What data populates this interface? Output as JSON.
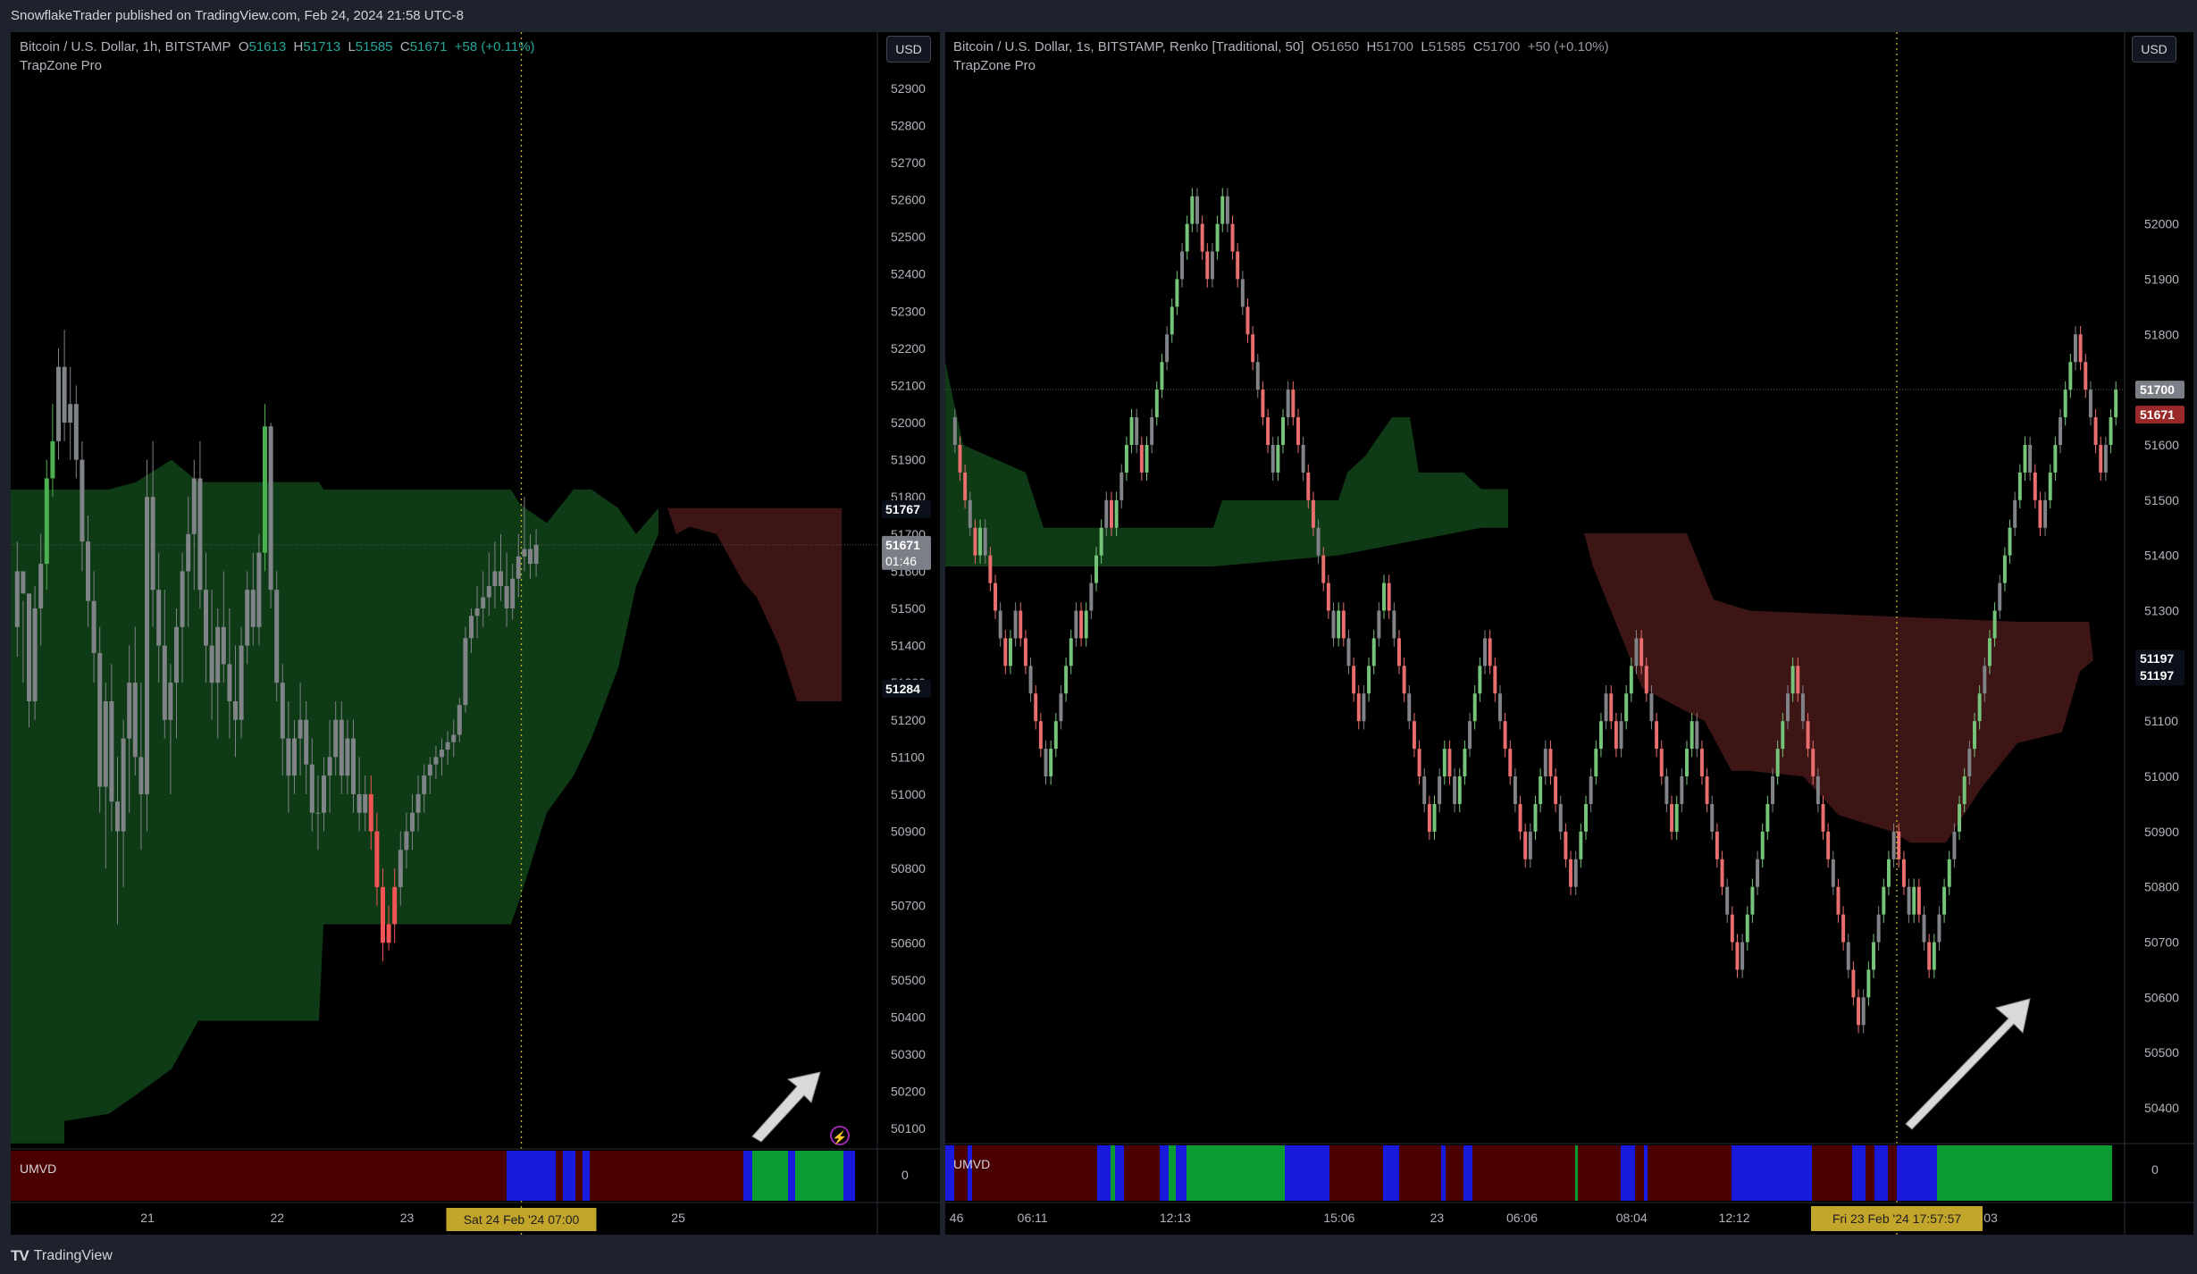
{
  "header": {
    "published": "SnowflakeTrader published on TradingView.com, Feb 24, 2024 21:58 UTC-8"
  },
  "footer": {
    "brand": "TradingView",
    "logo_icon": "tradingview-logo-icon"
  },
  "colors": {
    "bull": "#4caf50",
    "bear": "#f05454",
    "neutral": "#808489",
    "green_zone": "#0f3a16",
    "red_zone": "#3d1515",
    "umvd_red": "#4a0000",
    "umvd_blue": "#1a1adc",
    "umvd_green": "#0b9b32",
    "crosshair": "#c9b92a"
  },
  "left": {
    "legend": {
      "symbol": "Bitcoin / U.S. Dollar, 1h, BITSTAMP",
      "o_label": "O",
      "o": "51613",
      "h_label": "H",
      "h": "51713",
      "l_label": "L",
      "l": "51585",
      "c_label": "C",
      "c": "51671",
      "change": "+58 (+0.11%)"
    },
    "indicator": "TrapZone Pro",
    "currency": "USD",
    "umvd_label": "UMVD",
    "umvd_zero": "0",
    "price_badges": {
      "high": "51767",
      "last": "51671",
      "countdown": "01:46",
      "low": "51284"
    },
    "time_badge": "Sat 24 Feb '24   07:00"
  },
  "right": {
    "legend": {
      "symbol": "Bitcoin / U.S. Dollar, 1s, BITSTAMP, Renko [Traditional, 50]",
      "o_label": "O",
      "o": "51650",
      "h_label": "H",
      "h": "51700",
      "l_label": "L",
      "l": "51585",
      "c_label": "C",
      "c": "51700",
      "change": "+50 (+0.10%)"
    },
    "indicator": "TrapZone Pro",
    "currency": "USD",
    "umvd_label": "UMVD",
    "umvd_zero": "0",
    "price_badges": {
      "last": "51700",
      "ref": "51671",
      "a": "51197",
      "b": "51197"
    },
    "time_badge": "Fri 23 Feb '24   17:57:57"
  },
  "chart_data": [
    {
      "type": "candlestick",
      "title": "Bitcoin / U.S. Dollar, 1h, BITSTAMP",
      "ylim": [
        50050,
        52950
      ],
      "y_ticks": [
        52900,
        52800,
        52700,
        52600,
        52500,
        52400,
        52300,
        52200,
        52100,
        52000,
        51900,
        51800,
        51700,
        51600,
        51500,
        51400,
        51300,
        51200,
        51100,
        51000,
        50900,
        50800,
        50700,
        50600,
        50500,
        50400,
        50300,
        50200,
        50100
      ],
      "x_ticks": [
        {
          "label": "21",
          "i": 13
        },
        {
          "label": "22",
          "i": 35
        },
        {
          "label": "23",
          "i": 57
        },
        {
          "label": "25",
          "i": 103
        }
      ],
      "crosshair_index": 87,
      "last_price": 51671,
      "candles": [
        [
          51450,
          51680,
          51370,
          51600
        ],
        [
          51600,
          51520,
          51300,
          51540
        ],
        [
          51540,
          51350,
          51180,
          51250
        ],
        [
          51250,
          51560,
          51200,
          51500
        ],
        [
          51500,
          51700,
          51400,
          51620
        ],
        [
          51620,
          51900,
          51550,
          51850
        ],
        [
          51850,
          52050,
          51800,
          51950
        ],
        [
          51950,
          52200,
          51900,
          52150
        ],
        [
          52150,
          52250,
          51950,
          52000
        ],
        [
          52000,
          52150,
          51900,
          52050
        ],
        [
          52050,
          52100,
          51850,
          51900
        ],
        [
          51900,
          51950,
          51600,
          51680
        ],
        [
          51680,
          51750,
          51450,
          51520
        ],
        [
          51520,
          51600,
          51300,
          51380
        ],
        [
          51380,
          51450,
          50950,
          51020
        ],
        [
          51020,
          51300,
          50800,
          51250
        ],
        [
          51250,
          51350,
          50900,
          50980
        ],
        [
          50980,
          51100,
          50650,
          50900
        ],
        [
          50900,
          51200,
          50750,
          51150
        ],
        [
          51150,
          51400,
          50950,
          51300
        ],
        [
          51300,
          51450,
          51050,
          51100
        ],
        [
          51100,
          51300,
          50850,
          51000
        ],
        [
          51000,
          51900,
          50900,
          51800
        ],
        [
          51800,
          51950,
          51450,
          51550
        ],
        [
          51550,
          51650,
          51300,
          51400
        ],
        [
          51400,
          51550,
          51150,
          51200
        ],
        [
          51200,
          51350,
          51000,
          51300
        ],
        [
          51300,
          51500,
          51150,
          51450
        ],
        [
          51450,
          51650,
          51300,
          51600
        ],
        [
          51600,
          51800,
          51450,
          51700
        ],
        [
          51700,
          51900,
          51550,
          51850
        ],
        [
          51850,
          51950,
          51500,
          51550
        ],
        [
          51550,
          51650,
          51300,
          51400
        ],
        [
          51400,
          51550,
          51200,
          51300
        ],
        [
          51300,
          51500,
          51150,
          51450
        ],
        [
          51450,
          51600,
          51300,
          51350
        ],
        [
          51350,
          51500,
          51150,
          51250
        ],
        [
          51250,
          51400,
          51100,
          51200
        ],
        [
          51200,
          51450,
          51150,
          51400
        ],
        [
          51400,
          51600,
          51350,
          51550
        ],
        [
          51550,
          51650,
          51400,
          51450
        ],
        [
          51450,
          51700,
          51400,
          51650
        ],
        [
          51650,
          52050,
          51600,
          51990
        ],
        [
          51990,
          52000,
          51500,
          51550
        ],
        [
          51550,
          51600,
          51250,
          51300
        ],
        [
          51300,
          51350,
          51050,
          51150
        ],
        [
          51150,
          51250,
          50950,
          51050
        ],
        [
          51050,
          51200,
          51000,
          51150
        ],
        [
          51150,
          51300,
          51050,
          51200
        ],
        [
          51200,
          51250,
          51000,
          51080
        ],
        [
          51080,
          51150,
          50900,
          50950
        ],
        [
          50950,
          51050,
          50850,
          50950
        ],
        [
          50950,
          51100,
          50900,
          51050
        ],
        [
          51050,
          51200,
          50950,
          51100
        ],
        [
          51100,
          51250,
          51050,
          51200
        ],
        [
          51200,
          51250,
          51000,
          51050
        ],
        [
          51050,
          51200,
          51000,
          51150
        ],
        [
          51150,
          51200,
          50950,
          51000
        ],
        [
          51000,
          51100,
          50900,
          50950
        ],
        [
          50950,
          51050,
          50900,
          51000
        ],
        [
          51000,
          51050,
          50850,
          50900
        ],
        [
          50900,
          50950,
          50700,
          50750
        ],
        [
          50750,
          50800,
          50550,
          50600
        ],
        [
          50600,
          50700,
          50580,
          50650
        ],
        [
          50650,
          50800,
          50600,
          50750
        ],
        [
          50750,
          50900,
          50700,
          50850
        ],
        [
          50850,
          50950,
          50800,
          50900
        ],
        [
          50900,
          51000,
          50850,
          50950
        ],
        [
          50950,
          51050,
          50900,
          51000
        ],
        [
          51000,
          51080,
          50950,
          51050
        ],
        [
          51050,
          51100,
          51000,
          51080
        ],
        [
          51080,
          51130,
          51040,
          51100
        ],
        [
          51100,
          51150,
          51050,
          51120
        ],
        [
          51120,
          51170,
          51080,
          51140
        ],
        [
          51140,
          51200,
          51100,
          51160
        ],
        [
          51160,
          51260,
          51140,
          51240
        ],
        [
          51240,
          51450,
          51220,
          51420
        ],
        [
          51420,
          51500,
          51380,
          51480
        ],
        [
          51480,
          51560,
          51420,
          51500
        ],
        [
          51500,
          51600,
          51450,
          51530
        ],
        [
          51530,
          51650,
          51480,
          51560
        ],
        [
          51560,
          51680,
          51500,
          51600
        ],
        [
          51600,
          51700,
          51520,
          51560
        ],
        [
          51560,
          51650,
          51450,
          51500
        ],
        [
          51500,
          51620,
          51470,
          51580
        ],
        [
          51580,
          51700,
          51530,
          51640
        ],
        [
          51640,
          51800,
          51600,
          51660
        ],
        [
          51660,
          51700,
          51580,
          51620
        ],
        [
          51620,
          51713,
          51585,
          51671
        ]
      ]
    },
    {
      "type": "renko",
      "title": "Bitcoin / U.S. Dollar, 1s, BITSTAMP, Renko [Traditional, 50]",
      "ylim": [
        50350,
        52250
      ],
      "y_ticks": [
        52000,
        51900,
        51800,
        51700,
        51600,
        51500,
        51400,
        51300,
        51200,
        51100,
        51000,
        50900,
        50800,
        50700,
        50600,
        50500,
        50400
      ],
      "x_ticks": [
        {
          "label": "46",
          "frac": 0.005
        },
        {
          "label": "06:11",
          "frac": 0.074
        },
        {
          "label": "12:13",
          "frac": 0.195
        },
        {
          "label": "15:06",
          "frac": 0.334
        },
        {
          "label": "23",
          "frac": 0.417
        },
        {
          "label": "06:06",
          "frac": 0.489
        },
        {
          "label": "08:04",
          "frac": 0.582
        },
        {
          "label": "12:12",
          "frac": 0.669
        },
        {
          "label": "18:03",
          "frac": 0.879
        }
      ],
      "box_size": 50,
      "last_price": 51700,
      "path": [
        51650,
        51400,
        51450,
        51200,
        51300,
        51000,
        51150,
        51300,
        51250,
        51500,
        51450,
        51650,
        51550,
        51800,
        52050,
        51900,
        51900,
        52050,
        51850,
        51550,
        51700,
        51250,
        51300,
        51100,
        51350,
        51300,
        51050,
        50900,
        51050,
        50950,
        51250,
        51200,
        50850,
        51050,
        50950,
        50800,
        51150,
        51050,
        51250,
        50900,
        51100,
        50800,
        50750,
        50650,
        51000,
        51200,
        51000,
        50950,
        50750,
        50550,
        50900,
        50750,
        50800,
        50650,
        51300,
        51600,
        51450,
        51800,
        51550,
        51700
      ]
    }
  ]
}
